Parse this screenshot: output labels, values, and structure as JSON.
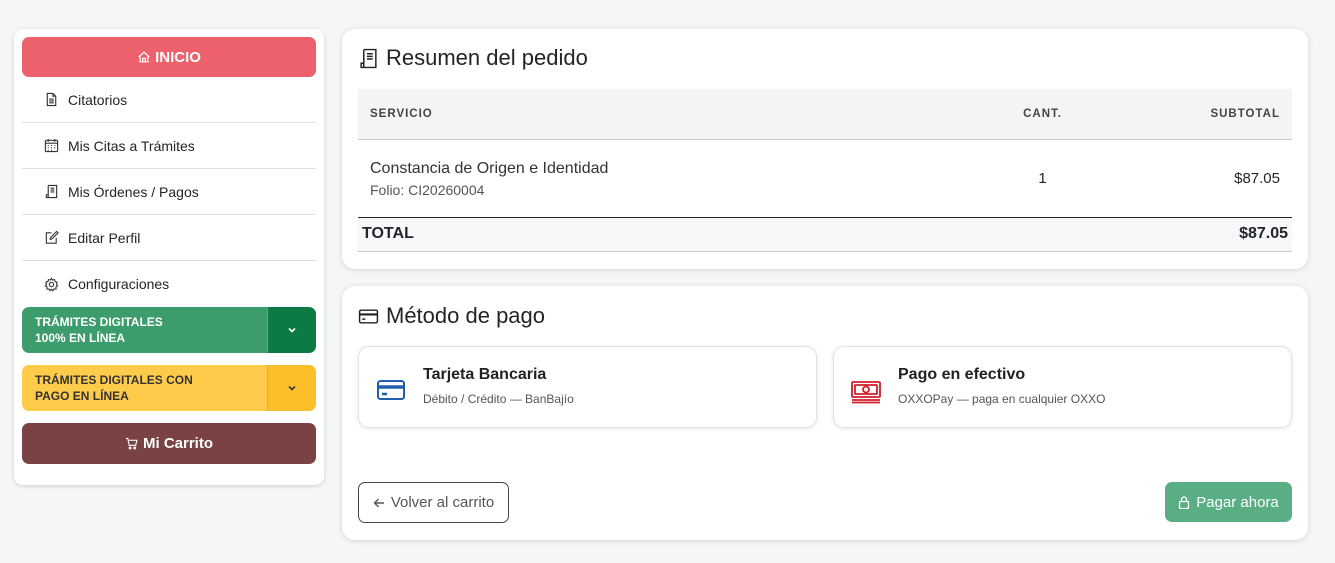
{
  "sidebar": {
    "home_label": "INICIO",
    "items": [
      {
        "label": "Citatorios",
        "icon": "document-icon"
      },
      {
        "label": "Mis Citas a Trámites",
        "icon": "calendar-icon"
      },
      {
        "label": "Mis Órdenes / Pagos",
        "icon": "receipt-icon"
      },
      {
        "label": "Editar Perfil",
        "icon": "edit-icon"
      },
      {
        "label": "Configuraciones",
        "icon": "gear-icon"
      }
    ],
    "dropdown_digital": {
      "line1": "TRÁMITES DIGITALES",
      "line2": "100% EN LÍNEA"
    },
    "dropdown_payment": {
      "line1": "TRÁMITES DIGITALES CON",
      "line2": "PAGO EN LÍNEA"
    },
    "cart_label": "Mi Carrito"
  },
  "summary": {
    "title": "Resumen del pedido",
    "columns": {
      "service": "SERVICIO",
      "qty": "CANT.",
      "subtotal": "SUBTOTAL"
    },
    "items": [
      {
        "name": "Constancia de Origen e Identidad",
        "folio": "Folio: CI20260004",
        "qty": "1",
        "subtotal": "$87.05"
      }
    ],
    "total_label": "TOTAL",
    "total_value": "$87.05"
  },
  "payment": {
    "title": "Método de pago",
    "options": [
      {
        "title": "Tarjeta Bancaria",
        "subtitle": "Débito / Crédito — BanBajío",
        "icon": "credit-card-icon"
      },
      {
        "title": "Pago en efectivo",
        "subtitle": "OXXOPay — paga en cualquier OXXO",
        "icon": "cash-icon"
      }
    ],
    "back_label": "Volver al carrito",
    "pay_label": "Pagar ahora"
  },
  "colors": {
    "home": "#ec616b",
    "green": "#3d9c6b",
    "green_dark": "#0c7a43",
    "yellow": "#ffcb4a",
    "cart": "#7a4242",
    "pay_button": "#5aae84",
    "card_icon": "#1f5fae",
    "cash_icon": "#d01f2a"
  }
}
